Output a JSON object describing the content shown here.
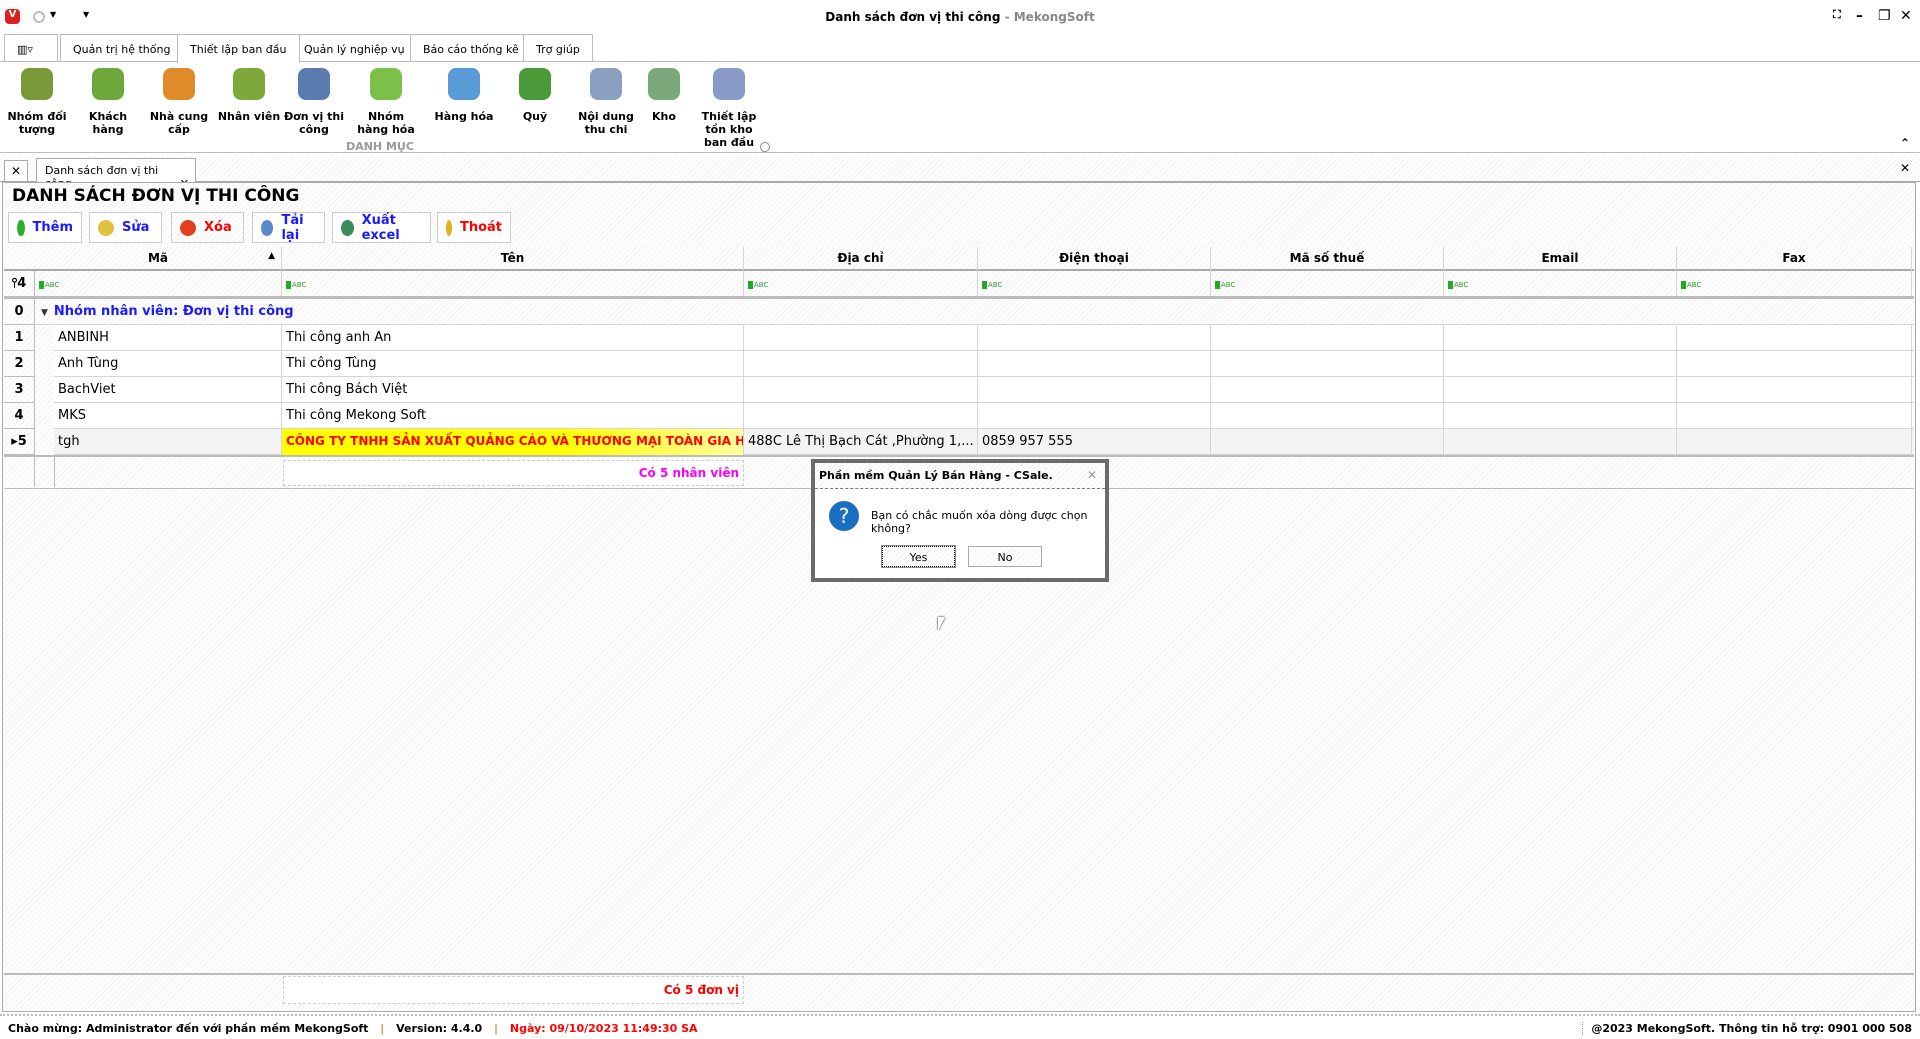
{
  "window": {
    "title": "Danh sách đơn vị thi công",
    "brand": " - MekongSoft"
  },
  "ribbon_tabs": [
    "Quản trị hệ thống",
    "Thiết lập ban đầu",
    "Quản lý nghiệp vụ",
    "Báo cáo thống kê",
    "Trợ giúp"
  ],
  "ribbon_items": [
    {
      "label": "Nhóm đối tượng",
      "icon": "people-group-icon",
      "color": "#7a9a3a"
    },
    {
      "label": "Khách hàng",
      "icon": "customer-icon",
      "color": "#6ea83a"
    },
    {
      "label": "Nhà cung cấp",
      "icon": "supplier-icon",
      "color": "#e08a2a"
    },
    {
      "label": "Nhân viên",
      "icon": "employee-icon",
      "color": "#7fa83a"
    },
    {
      "label": "Đơn vị thi công",
      "icon": "worker-icon",
      "color": "#5a7ab0"
    },
    {
      "label": "Nhóm hàng hóa",
      "icon": "product-group-icon",
      "color": "#7cc04a"
    },
    {
      "label": "Hàng hóa",
      "icon": "star-icon",
      "color": "#5a9ad8"
    },
    {
      "label": "Quỹ",
      "icon": "money-icon",
      "color": "#4a9a3a"
    },
    {
      "label": "Nội dung thu chi",
      "icon": "document-add-icon",
      "color": "#8aa0c0"
    },
    {
      "label": "Kho",
      "icon": "house-icon",
      "color": "#7aa87a"
    },
    {
      "label": "Thiết lập tồn kho ban đầu",
      "icon": "inventory-icon",
      "color": "#8a9ac8"
    }
  ],
  "ribbon_group": "DANH MỤC",
  "doc_tab": "Danh sách đơn vị thi công",
  "page_title": "DANH SÁCH ĐƠN VỊ THI CÔNG",
  "toolbar": [
    {
      "label": "Thêm",
      "color": "#1a1aff",
      "icon": "#2cae2c"
    },
    {
      "label": "Sửa",
      "color": "#1a1aff",
      "icon": "#e0c040"
    },
    {
      "label": "Xóa",
      "color": "#ff0000",
      "icon": "#e04020"
    },
    {
      "label": "Tải lại",
      "color": "#1a1aff",
      "icon": "#5a8ac8"
    },
    {
      "label": "Xuất excel",
      "color": "#1a1aff",
      "icon": "#3a8a5a"
    },
    {
      "label": "Thoát",
      "color": "#ff0000",
      "icon": "#e0b020"
    }
  ],
  "grid": {
    "columns": [
      "Mã",
      "Tên",
      "Địa chỉ",
      "Điện thoại",
      "Mã số thuế",
      "Email",
      "Fax"
    ],
    "filter_count": "4",
    "group": {
      "index": "0",
      "label": "Nhóm nhân viên: Đơn vị thi công",
      "summary": "Có 5 nhân viên"
    },
    "rows": [
      {
        "n": "1",
        "ma": "ANBINH",
        "ten": "Thi công anh An",
        "diachi": "",
        "dt": ""
      },
      {
        "n": "2",
        "ma": "Anh Tùng",
        "ten": "Thi công Tùng",
        "diachi": "",
        "dt": ""
      },
      {
        "n": "3",
        "ma": "BachViet",
        "ten": "Thi công Bách Việt",
        "diachi": "",
        "dt": ""
      },
      {
        "n": "4",
        "ma": "MKS",
        "ten": "Thi công Mekong Soft",
        "diachi": "",
        "dt": ""
      },
      {
        "n": "5",
        "ma": "tgh",
        "ten": "CÔNG TY TNHH SẢN XUẤT QUẢNG CÁO VÀ THƯƠNG MẠI TOÀN GIA HƯNG",
        "diachi": "488C Lê Thị Bạch Cát ,Phường 1,...",
        "dt": "0859 957 555"
      }
    ],
    "footer_total": "Có 5 đơn vị"
  },
  "dialog": {
    "title": "Phần mềm Quản Lý Bán Hàng - CSale.",
    "message": "Bạn có chắc muốn xóa dòng được chọn không?",
    "yes": "Yes",
    "no": "No"
  },
  "status": {
    "welcome": "Chào mừng: Administrator đến với phần mềm MekongSoft",
    "version": "Version: 4.4.0",
    "date": "Ngày: 09/10/2023 11:49:30 SA",
    "copyright": "@2023 MekongSoft. Thông tin hỗ trợ: 0901 000 508"
  }
}
